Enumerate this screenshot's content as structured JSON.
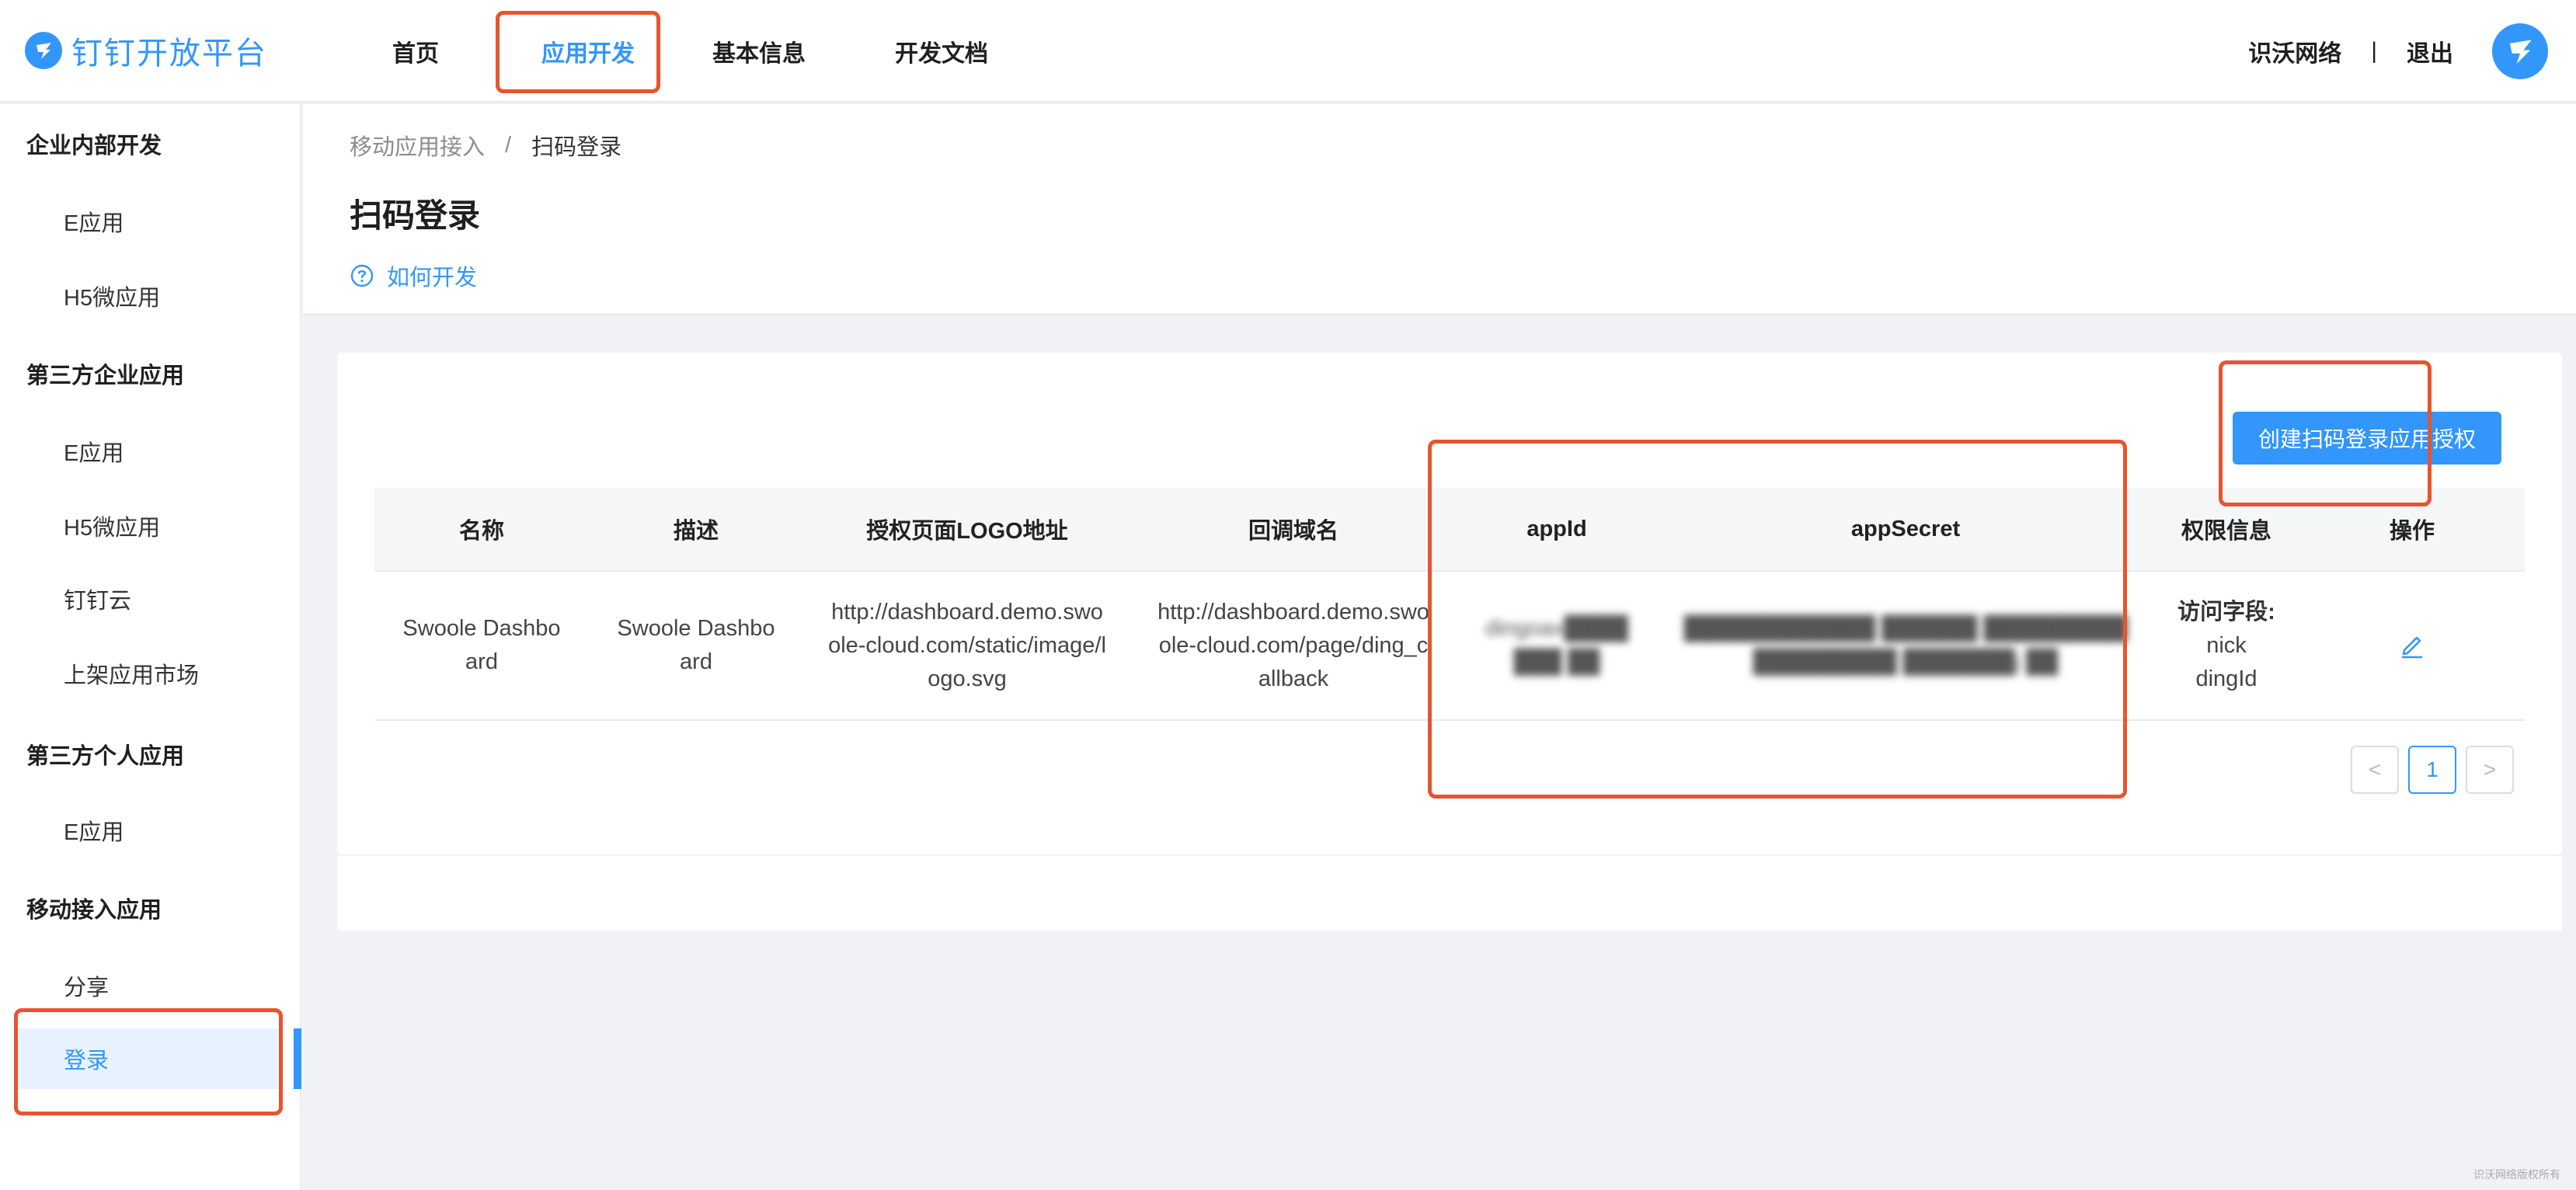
{
  "brand": {
    "name": "钉钉开放平台",
    "color": "#3296fa"
  },
  "nav": [
    {
      "label": "首页"
    },
    {
      "label": "应用开发"
    },
    {
      "label": "基本信息"
    },
    {
      "label": "开发文档"
    }
  ],
  "user": {
    "org": "识沃网络",
    "separator": "|",
    "logout": "退出"
  },
  "sidebar": {
    "groups": [
      {
        "title": "企业内部开发",
        "items": [
          "E应用",
          "H5微应用"
        ]
      },
      {
        "title": "第三方企业应用",
        "items": [
          "E应用",
          "H5微应用",
          "钉钉云",
          "上架应用市场"
        ]
      },
      {
        "title": "第三方个人应用",
        "items": [
          "E应用"
        ]
      },
      {
        "title": "移动接入应用",
        "items": [
          "分享",
          "登录"
        ]
      }
    ]
  },
  "breadcrumb": {
    "parent": "移动应用接入",
    "separator": "/",
    "current": "扫码登录"
  },
  "page": {
    "title": "扫码登录",
    "howto": "如何开发",
    "create_button": "创建扫码登录应用授权"
  },
  "table": {
    "columns": [
      "名称",
      "描述",
      "授权页面LOGO地址",
      "回调域名",
      "appId",
      "appSecret",
      "权限信息",
      "操作"
    ],
    "rows": [
      {
        "name": "Swoole Dashboard",
        "description": "Swoole Dashboard",
        "logo_url": "http://dashboard.demo.swoole-cloud.com/static/image/logo.svg",
        "callback": "http://dashboard.demo.swoole-cloud.com/page/ding_callback",
        "appid": "dingoax████ ███ ██",
        "appsecret": "████████████ ██████ ██████████████████ ███████j ██",
        "perm_label": "访问字段:",
        "perm_fields": [
          "nick",
          "dingId"
        ]
      }
    ]
  },
  "pagination": {
    "prev": "<",
    "current": "1",
    "next": ">"
  },
  "watermark": "识沃网络版权所有"
}
